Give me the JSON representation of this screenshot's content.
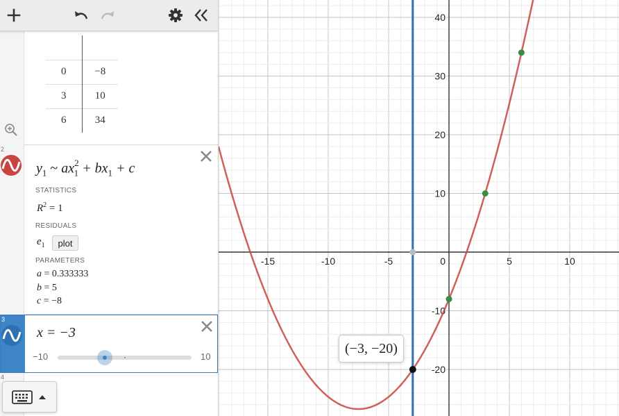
{
  "toolbar": {
    "add_icon": "plus-icon",
    "undo_icon": "undo-icon",
    "redo_icon": "redo-icon",
    "settings_icon": "gear-icon",
    "collapse_icon": "double-chevron-left-icon"
  },
  "table": {
    "rows": [
      {
        "x": "0",
        "y": "−8"
      },
      {
        "x": "3",
        "y": "10"
      },
      {
        "x": "6",
        "y": "34"
      }
    ]
  },
  "regression": {
    "number": "2",
    "color": "#c74440",
    "formula": {
      "y": "y",
      "sub": "1",
      "tilde": " ~ ",
      "ax": "ax",
      "sup": "2",
      "sub2": "1",
      "plus_bx": " + bx",
      "sub3": "1",
      "plus_c": " + c"
    },
    "statistics_label": "STATISTICS",
    "r_squared": {
      "r": "R",
      "sup": "2",
      "eq": " = 1"
    },
    "residuals_label": "RESIDUALS",
    "residual_var": {
      "e": "e",
      "sub": "1"
    },
    "plot_label": "plot",
    "parameters_label": "PARAMETERS",
    "parameters": [
      {
        "name": "a",
        "value": " = 0.333333"
      },
      {
        "name": "b",
        "value": " = 5"
      },
      {
        "name": "c",
        "value": " = −8"
      }
    ]
  },
  "slider_expr": {
    "number": "3",
    "color": "#2d70b3",
    "expression": "x = −3",
    "min_label": "−10",
    "max_label": "10",
    "value_fraction": 0.35
  },
  "empty_expr": {
    "number": "4"
  },
  "graph": {
    "x_ticks": [
      "-15",
      "-10",
      "-5",
      "0",
      "5",
      "10"
    ],
    "y_ticks": [
      "40",
      "30",
      "20",
      "10",
      "-10",
      "-20"
    ],
    "point_label": "(−3, −20)",
    "curve_color": "#c74440",
    "line_color": "#2d70b3",
    "data_point_color": "#388c46"
  }
}
